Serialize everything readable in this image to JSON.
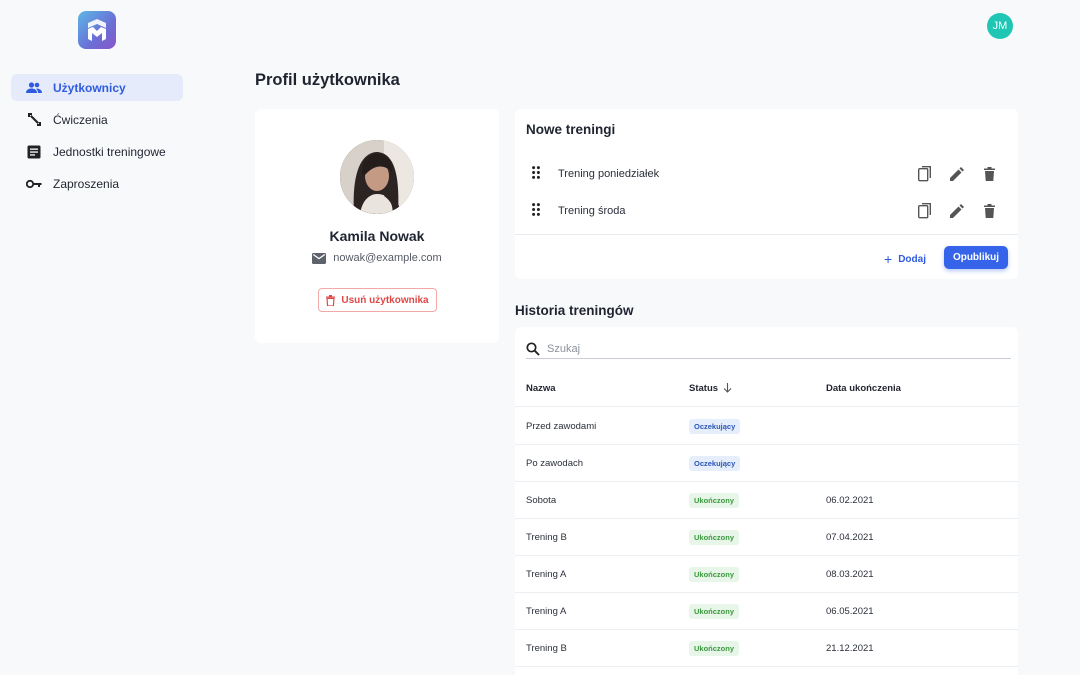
{
  "header": {
    "user_initials": "JM"
  },
  "sidebar": {
    "items": [
      {
        "label": "Użytkownicy",
        "icon": "users-icon",
        "active": true
      },
      {
        "label": "Ćwiczenia",
        "icon": "dumbbell-icon",
        "active": false
      },
      {
        "label": "Jednostki treningowe",
        "icon": "document-icon",
        "active": false
      },
      {
        "label": "Zaproszenia",
        "icon": "key-icon",
        "active": false
      }
    ]
  },
  "page": {
    "title": "Profil użytkownika"
  },
  "profile": {
    "name": "Kamila Nowak",
    "email": "nowak@example.com",
    "remove_label": "Usuń użytkownika"
  },
  "new_trainings": {
    "title": "Nowe treningi",
    "items": [
      {
        "label": "Trening poniedziałek"
      },
      {
        "label": "Trening środa"
      }
    ],
    "add_label": "Dodaj",
    "publish_label": "Opublikuj"
  },
  "history": {
    "title": "Historia treningów",
    "search_placeholder": "Szukaj",
    "columns": {
      "name": "Nazwa",
      "status": "Status",
      "status_sort_icon": "arrow-down-icon",
      "date": "Data ukończenia"
    },
    "rows": [
      {
        "name": "Przed zawodami",
        "status": "Oczekujący",
        "kind": "pending",
        "date": ""
      },
      {
        "name": "Po zawodach",
        "status": "Oczekujący",
        "kind": "pending",
        "date": ""
      },
      {
        "name": "Sobota",
        "status": "Ukończony",
        "kind": "done",
        "date": "06.02.2021"
      },
      {
        "name": "Trening B",
        "status": "Ukończony",
        "kind": "done",
        "date": "07.04.2021"
      },
      {
        "name": "Trening A",
        "status": "Ukończony",
        "kind": "done",
        "date": "08.03.2021"
      },
      {
        "name": "Trening A",
        "status": "Ukończony",
        "kind": "done",
        "date": "06.05.2021"
      },
      {
        "name": "Trening B",
        "status": "Ukończony",
        "kind": "done",
        "date": "21.12.2021"
      }
    ]
  },
  "colors": {
    "accent": "#3563e9",
    "danger": "#e04848",
    "pending_bg": "#e6eefb",
    "done_bg": "#e7f6e8",
    "avatar": "#1fc6b4"
  }
}
